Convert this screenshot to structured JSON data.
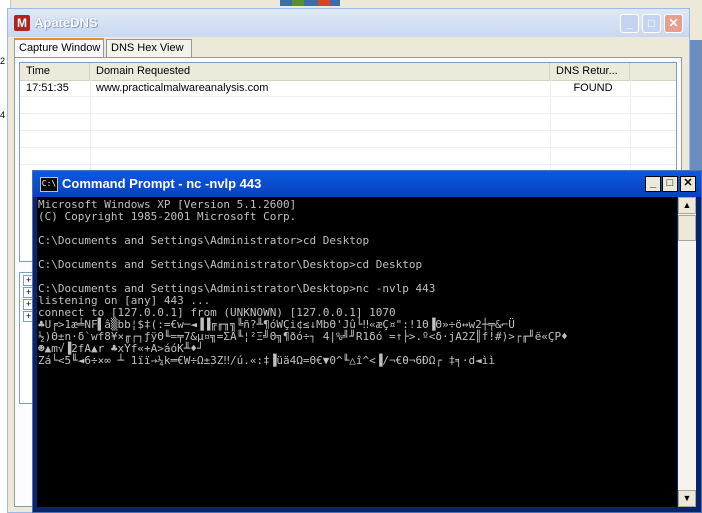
{
  "apatedns": {
    "title": "ApateDNS",
    "tabs": [
      {
        "label": "Capture Window"
      },
      {
        "label": "DNS Hex View"
      }
    ],
    "table": {
      "columns": [
        "Time",
        "Domain Requested",
        "DNS Retur..."
      ],
      "rows": [
        {
          "time": "17:51:35",
          "domain": "www.practicalmalwareanalysis.com",
          "result": "FOUND"
        }
      ]
    }
  },
  "cmd": {
    "title": "Command Prompt - nc -nvlp 443",
    "output": "Microsoft Windows XP [Version 5.1.2600]\n(C) Copyright 1985-2001 Microsoft Corp.\n\nC:\\Documents and Settings\\Administrator>cd Desktop\n\nC:\\Documents and Settings\\Administrator\\Desktop>cd Desktop\n\nC:\\Documents and Settings\\Administrator\\Desktop>nc -nvlp 443\nlistening on [any] 443 ...\nconnect to [127.0.0.1] from (UNKNOWN) [127.0.0.1] 1070\n♣U╒>1æ╧NF▌â▒bb¦$‡(:=€w─◄▐▐╔╓╖╗╚ñ?╨¶óWÇi¢≤↓MbΘ'Jû└‼«æÇ¤\":!1Θ▐Θ»÷ö↔w2┼╤&⌐Ü\n½)Θ±n·δ`wf8¥×╓┌┐ƒÿΘ╙=╤7&µ¤╗=ΣÄ╙¦²Ξ╝Θ╗¶ðó÷┐ 4|%╝╜R1δó =↑├>.º<δ·jA2Z║f!#)>┌╓╜ë«ÇP♦\n☻▲m√▐2fA▲r ♣xÝf«+A>áóK╨♦┘\nZá└<5╙◄6÷×∞ ┴ 1ïï→¼k═€W÷Ω±3Z‼/ú.«:‡▐üä4Ω=Θ€▼0^╙△î^<▐/¬€θ¬6ÐΩ┌ ‡╕·d◄ìì"
  },
  "background": {
    "left_numbers": [
      "2",
      "4"
    ]
  }
}
